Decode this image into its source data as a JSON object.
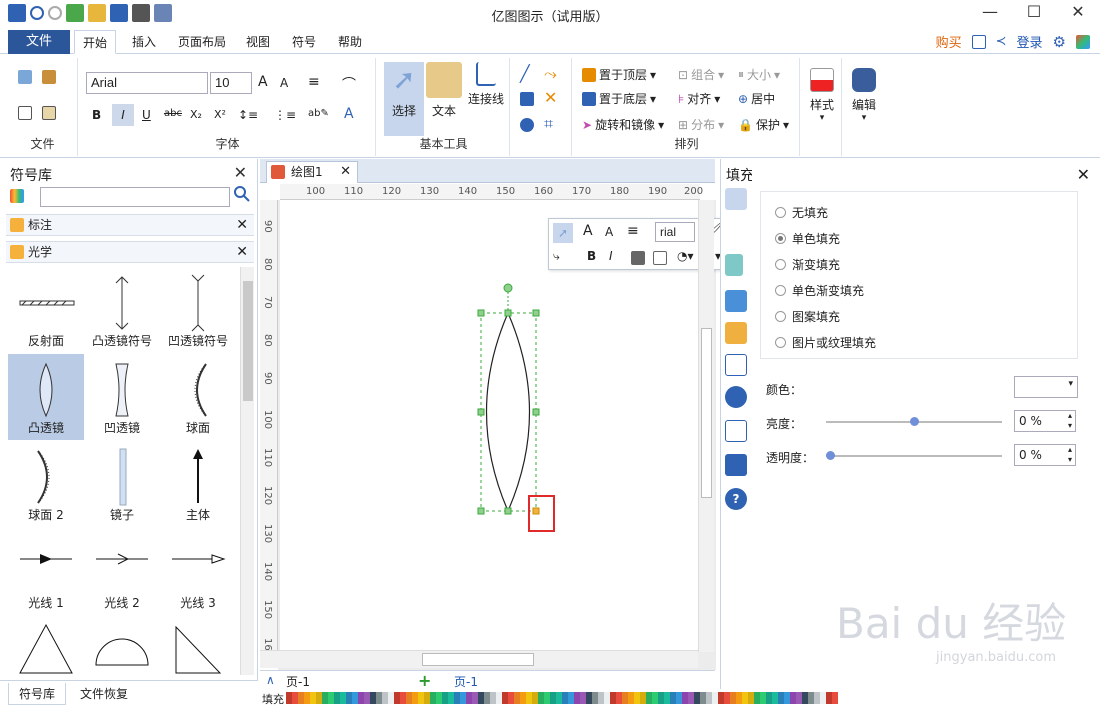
{
  "app": {
    "title": "亿图图示（试用版）"
  },
  "tabs": {
    "file": "文件",
    "items": [
      "开始",
      "插入",
      "页面布局",
      "视图",
      "符号",
      "帮助"
    ],
    "buy": "购买",
    "login": "登录"
  },
  "ribbon": {
    "file_group": "文件",
    "font_group": "字体",
    "font_name": "Arial",
    "font_size": "10",
    "tools_group": "基本工具",
    "select": "选择",
    "text": "文本",
    "connector": "连接线",
    "arrange_group": "排列",
    "bring_front": "置于顶层",
    "send_back": "置于底层",
    "rotate_mirror": "旋转和镜像",
    "group": "组合",
    "align": "对齐",
    "distribute": "分布",
    "size": "大小",
    "center": "居中",
    "protect": "保护",
    "style": "样式",
    "edit": "编辑"
  },
  "library": {
    "title": "符号库",
    "sections": [
      "标注",
      "光学"
    ],
    "shapes": [
      "反射面",
      "凸透镜符号",
      "凹透镜符号",
      "凸透镜",
      "凹透镜",
      "球面",
      "球面 2",
      "镜子",
      "主体",
      "光线 1",
      "光线 2",
      "光线 3"
    ],
    "bottom_tabs": [
      "符号库",
      "文件恢复"
    ]
  },
  "document": {
    "tab": "绘图1",
    "ruler_h": [
      "100",
      "110",
      "120",
      "130",
      "140",
      "150",
      "160",
      "170",
      "180",
      "190",
      "200"
    ],
    "ruler_v": [
      "90",
      "80",
      "70",
      "80",
      "90",
      "100",
      "110",
      "120",
      "130",
      "140",
      "150",
      "160"
    ],
    "page_select": "页-1",
    "page_tab": "页-1",
    "color_label": "填充",
    "float_font": "rial"
  },
  "fill": {
    "title": "填充",
    "options": [
      "无填充",
      "单色填充",
      "渐变填充",
      "单色渐变填充",
      "图案填充",
      "图片或纹理填充"
    ],
    "selected": 1,
    "color_label": "颜色：",
    "brightness_label": "亮度：",
    "brightness_value": "0 %",
    "transparency_label": "透明度：",
    "transparency_value": "0 %",
    "brightness_level": 0.5,
    "transparency_level": 0.0
  },
  "watermark": {
    "main": "Bai du 经验",
    "sub": "jingyan.baidu.com"
  },
  "colors": {
    "accent": "#2b579a",
    "selection": "#b9cbe5",
    "highlight": "#e02a2a",
    "handle": "#5cb85c"
  }
}
